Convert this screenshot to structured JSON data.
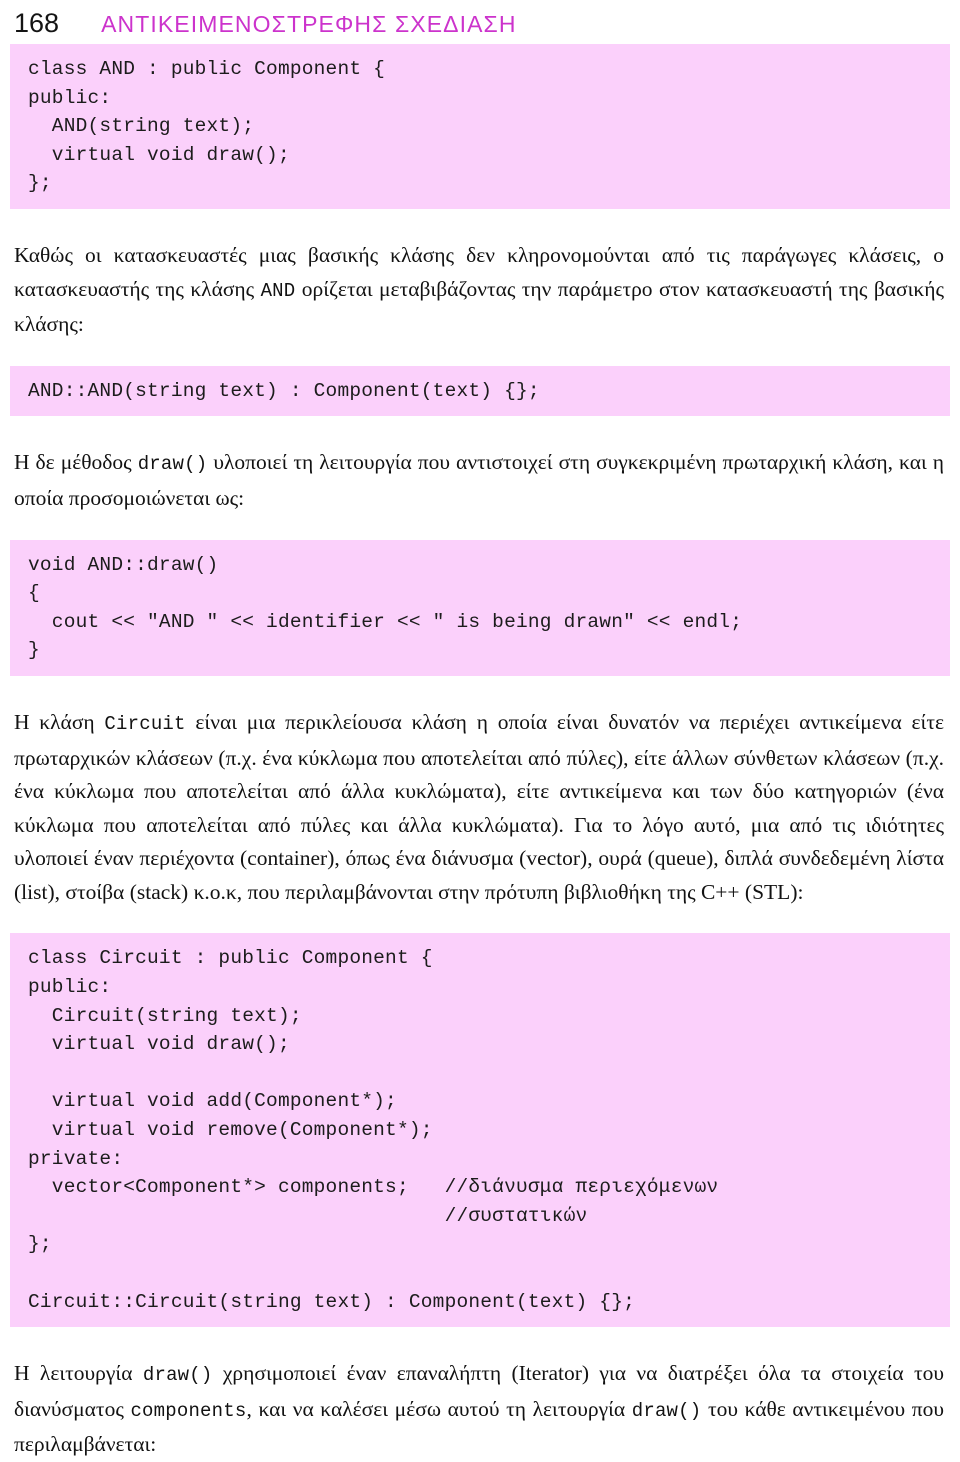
{
  "header": {
    "folio": "168",
    "title": "ΑΝΤΙΚΕΙΜΕΝΟΣΤΡΕΦΗΣ ΣΧΕΔΙΑΣΗ",
    "title_color": "#cc33cc"
  },
  "theme": {
    "code_background": "#fbd0fb",
    "text_color": "#121212",
    "page_background": "#ffffff"
  },
  "blocks": {
    "and_class_code": [
      "class AND : public Component {",
      "public:",
      "  AND(string text);",
      "  virtual void draw();",
      "};"
    ],
    "paragraph_1": "Καθώς οι κατασκευαστές μιας βασικής κλάσης δεν κληρονομούνται από τις παράγωγες κλάσεις, ο κατασκευαστής της κλάσης ",
    "paragraph_1_mono": "AND",
    "paragraph_1_cont": " ορίζεται μεταβιβάζοντας την παράμετρο στον κατασκευαστή της βασικής κλάσης:",
    "and_ctor_code": [
      "AND::AND(string text) : Component(text) {};"
    ],
    "paragraph_2_a": "Η δε μέθοδος ",
    "paragraph_2_mono": "draw()",
    "paragraph_2_b": " υλοποιεί τη λειτουργία που αντιστοιχεί στη συγκεκριμένη πρωταρχική κλάση, και η οποία προσομοιώνεται ως:",
    "and_draw_code": [
      "void AND::draw()",
      "{",
      "  cout << \"AND \" << identifier << \" is being drawn\" << endl;",
      "}"
    ],
    "paragraph_3_a": "Η κλάση ",
    "paragraph_3_mono": "Circuit",
    "paragraph_3_b": " είναι μια περικλείουσα κλάση η οποία είναι δυνατόν να περιέχει αντικείμενα είτε πρωταρχικών κλάσεων (π.χ. ένα κύκλωμα που αποτελείται από πύλες), είτε άλλων σύνθετων κλάσεων (π.χ. ένα κύκλωμα που αποτελείται από άλλα κυκλώματα), είτε αντικείμενα και των δύο κατηγοριών (ένα κύκλωμα που αποτελείται από πύλες και άλλα κυκλώματα). Για το λόγο αυτό, μια από τις ιδιότητες υλοποιεί έναν περιέχοντα (container), όπως ένα διάνυσμα (vector), ουρά (queue), διπλά συνδεδεμένη λίστα (list), στοίβα (stack) κ.ο.κ, που περιλαμβάνονται στην πρότυπη βιβλιοθήκη της C++ (STL):",
    "circuit_class_code": [
      "class Circuit : public Component {",
      "public:",
      "  Circuit(string text);",
      "  virtual void draw();",
      "",
      "  virtual void add(Component*);",
      "  virtual void remove(Component*);",
      "private:",
      "  vector<Component*> components;   //διάνυσμα περιεχόμενων",
      "                                   //συστατικών",
      "};",
      "",
      "Circuit::Circuit(string text) : Component(text) {};"
    ],
    "paragraph_4_a": "Η λειτουργία ",
    "paragraph_4_mono_1": "draw()",
    "paragraph_4_b": " χρησιμοποιεί έναν επαναλήπτη (Iterator) για να διατρέξει όλα τα στοιχεία του διανύσματος ",
    "paragraph_4_mono_2": "components",
    "paragraph_4_c": ", και να καλέσει μέσω αυτού τη λειτουργία ",
    "paragraph_4_mono_3": "draw()",
    "paragraph_4_d": " του κάθε αντικειμένου που περιλαμβάνεται:"
  }
}
